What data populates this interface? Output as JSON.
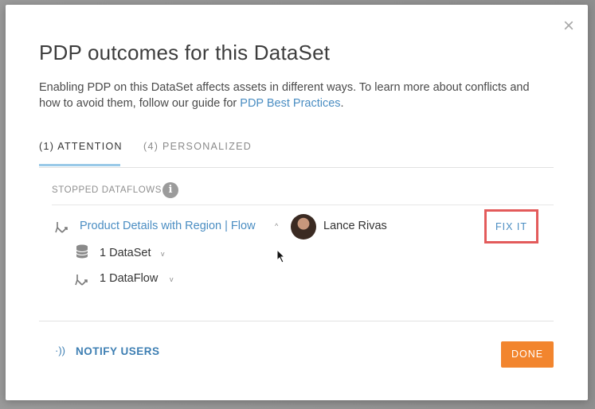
{
  "dialog": {
    "title": "PDP outcomes for this DataSet",
    "description_pre": "Enabling PDP on this DataSet affects assets in different ways. To learn more about conflicts and how to avoid them, follow our guide for ",
    "description_link": "PDP Best Practices",
    "description_post": ".",
    "close_icon": "close-icon"
  },
  "tabs": [
    {
      "label": "(1) ATTENTION",
      "active": true
    },
    {
      "label": "(4) PERSONALIZED",
      "active": false
    }
  ],
  "section": {
    "label": "STOPPED DATAFLOWS",
    "info_icon": "info-icon"
  },
  "flow": {
    "icon": "dataflow-icon",
    "name": "Product Details with Region | Flow",
    "caret": "^",
    "owner": "Lance Rivas",
    "action": "FIX IT",
    "children": [
      {
        "icon": "database-icon",
        "label": "1 DataSet",
        "caret": "v"
      },
      {
        "icon": "dataflow-icon",
        "label": "1 DataFlow",
        "caret": "v"
      }
    ]
  },
  "footer": {
    "notify_icon": "broadcast-icon",
    "notify_label": "NOTIFY USERS",
    "done_label": "DONE"
  },
  "colors": {
    "link": "#4a8dc2",
    "done": "#f2852e",
    "highlight": "#e35b5b",
    "tab_active_underline": "#99c9e8"
  }
}
